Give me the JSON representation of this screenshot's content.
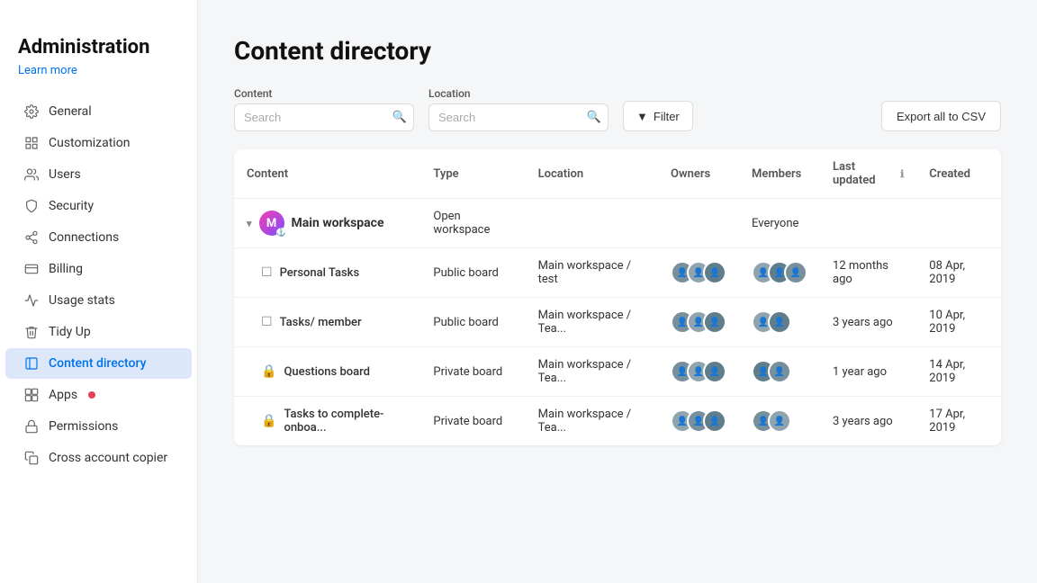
{
  "sidebar": {
    "title": "Administration",
    "learn_more": "Learn more",
    "items": [
      {
        "id": "general",
        "label": "General",
        "icon": "settings-icon",
        "active": false
      },
      {
        "id": "customization",
        "label": "Customization",
        "icon": "customization-icon",
        "active": false
      },
      {
        "id": "users",
        "label": "Users",
        "icon": "users-icon",
        "active": false
      },
      {
        "id": "security",
        "label": "Security",
        "icon": "security-icon",
        "active": false
      },
      {
        "id": "connections",
        "label": "Connections",
        "icon": "connections-icon",
        "active": false
      },
      {
        "id": "billing",
        "label": "Billing",
        "icon": "billing-icon",
        "active": false
      },
      {
        "id": "usage-stats",
        "label": "Usage stats",
        "icon": "stats-icon",
        "active": false
      },
      {
        "id": "tidy-up",
        "label": "Tidy Up",
        "icon": "tidy-icon",
        "active": false
      },
      {
        "id": "content-directory",
        "label": "Content directory",
        "icon": "content-icon",
        "active": true
      },
      {
        "id": "apps",
        "label": "Apps",
        "icon": "apps-icon",
        "active": false,
        "badge": true
      },
      {
        "id": "permissions",
        "label": "Permissions",
        "icon": "permissions-icon",
        "active": false
      },
      {
        "id": "cross-account-copier",
        "label": "Cross account copier",
        "icon": "copy-icon",
        "active": false
      }
    ]
  },
  "page": {
    "title": "Content directory"
  },
  "filters": {
    "content_label": "Content",
    "content_placeholder": "Search",
    "location_label": "Location",
    "location_placeholder": "Search",
    "filter_label": "Filter",
    "export_label": "Export all to CSV"
  },
  "table": {
    "columns": [
      "Content",
      "Type",
      "Location",
      "Owners",
      "Members",
      "Last updated",
      "Created"
    ],
    "rows": [
      {
        "type": "workspace",
        "name": "Main workspace",
        "badge_letter": "M",
        "item_type": "Open workspace",
        "location": "",
        "owners": "",
        "members": "Everyone",
        "last_updated": "",
        "created": "",
        "expanded": true
      },
      {
        "type": "board",
        "name": "Personal Tasks",
        "item_type": "Public board",
        "location": "Main workspace / test",
        "has_owners": true,
        "has_members": true,
        "last_updated": "12 months ago",
        "created": "08 Apr, 2019"
      },
      {
        "type": "board",
        "name": "Tasks/ member",
        "item_type": "Public board",
        "location": "Main workspace / Tea...",
        "has_owners": true,
        "has_members": true,
        "last_updated": "3 years ago",
        "created": "10 Apr, 2019"
      },
      {
        "type": "private-board",
        "name": "Questions board",
        "item_type": "Private board",
        "location": "Main workspace / Tea...",
        "has_owners": true,
        "has_members": true,
        "last_updated": "1 year ago",
        "created": "14 Apr, 2019"
      },
      {
        "type": "private-board",
        "name": "Tasks to complete-onboa...",
        "item_type": "Private board",
        "location": "Main workspace / Tea...",
        "has_owners": true,
        "has_members": true,
        "last_updated": "3 years ago",
        "created": "17 Apr, 2019"
      }
    ]
  }
}
